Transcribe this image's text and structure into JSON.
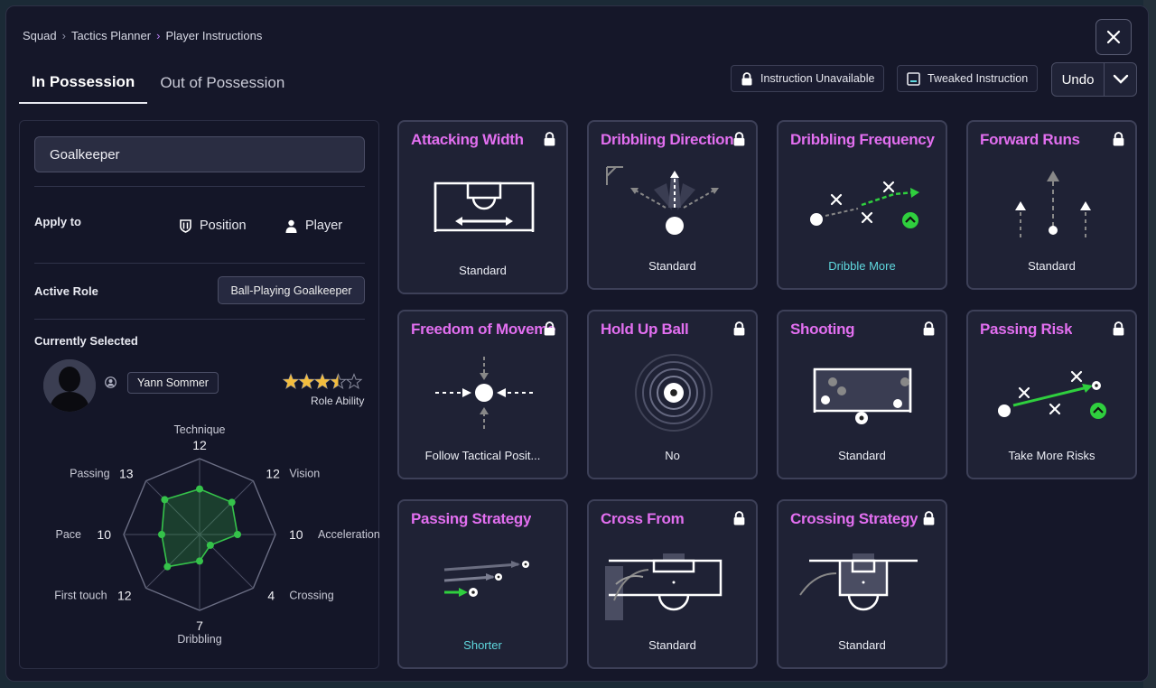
{
  "breadcrumb": [
    "Squad",
    "Tactics Planner",
    "Player Instructions"
  ],
  "tabs": [
    {
      "label": "In Possession",
      "active": true
    },
    {
      "label": "Out of Possession",
      "active": false
    }
  ],
  "legend": {
    "unavailable": "Instruction Unavailable",
    "tweaked": "Tweaked Instruction"
  },
  "undo_label": "Undo",
  "left": {
    "player_select": "Goalkeeper",
    "apply_to_label": "Apply to",
    "apply_position": "Position",
    "apply_player": "Player",
    "active_role_label": "Active Role",
    "active_role": "Ball-Playing Goalkeeper",
    "currently_selected_label": "Currently Selected",
    "player_name": "Yann Sommer",
    "role_ability_label": "Role Ability",
    "role_ability_stars": 3.5
  },
  "attributes": [
    {
      "label": "Technique",
      "value": "12"
    },
    {
      "label": "Vision",
      "value": "12"
    },
    {
      "label": "Acceleration",
      "value": "10"
    },
    {
      "label": "Crossing",
      "value": "4"
    },
    {
      "label": "Dribbling",
      "value": "7"
    },
    {
      "label": "First touch",
      "value": "12"
    },
    {
      "label": "Pace",
      "value": "10"
    },
    {
      "label": "Passing",
      "value": "13"
    }
  ],
  "cards": [
    {
      "title": "Attacking Width",
      "value": "Standard",
      "locked": true
    },
    {
      "title": "Dribbling Direction",
      "value": "Standard",
      "locked": true
    },
    {
      "title": "Dribbling Frequency",
      "value": "Dribble More",
      "locked": false
    },
    {
      "title": "Forward Runs",
      "value": "Standard",
      "locked": true
    },
    {
      "title": "Freedom of Movement",
      "value": "Follow Tactical Posit...",
      "locked": true
    },
    {
      "title": "Hold Up Ball",
      "value": "No",
      "locked": true
    },
    {
      "title": "Shooting",
      "value": "Standard",
      "locked": true
    },
    {
      "title": "Passing Risk",
      "value": "Take More Risks",
      "locked": true
    },
    {
      "title": "Passing Strategy",
      "value": "Shorter",
      "locked": false
    },
    {
      "title": "Cross From",
      "value": "Standard",
      "locked": true
    },
    {
      "title": "Crossing Strategy",
      "value": "Standard",
      "locked": true
    }
  ]
}
